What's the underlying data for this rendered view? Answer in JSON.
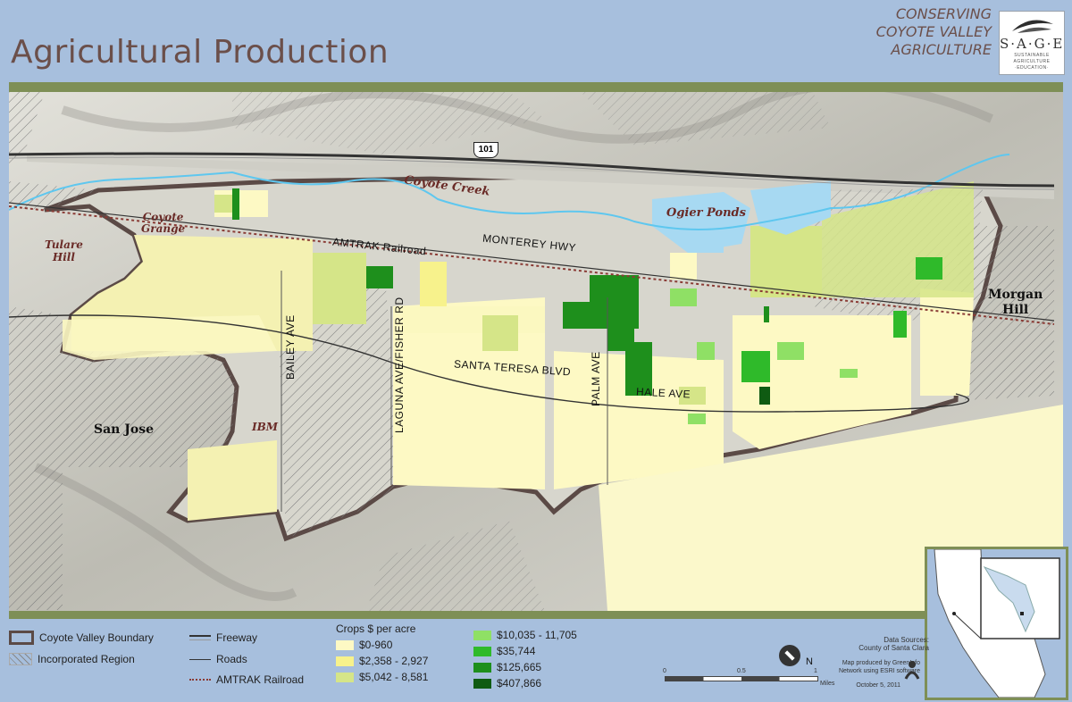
{
  "header": {
    "title": "Agricultural Production",
    "project_lines": [
      "CONSERVING",
      "COYOTE VALLEY",
      "AGRICULTURE"
    ],
    "logo": {
      "word": "S·A·G·E",
      "lines": [
        "SUSTAINABLE",
        "AGRICULTURE",
        "·EDUCATION·"
      ]
    }
  },
  "map": {
    "highway_shield": "101",
    "roads": {
      "bailey": "BAILEY AVE",
      "laguna": "LAGUNA AVE/FISHER RD",
      "santa_teresa": "SANTA TERESA BLVD",
      "palm": "PALM AVE",
      "hale": "HALE AVE",
      "monterey": "MONTEREY HWY",
      "amtrak": "AMTRAK Railroad"
    },
    "water": {
      "creek": "Coyote Creek",
      "ponds": "Ogier Ponds"
    },
    "places": {
      "grange": "Coyote\nGrange",
      "tulare": "Tulare\nHill",
      "ibm": "IBM"
    },
    "towns": {
      "san_jose": "San Jose",
      "morgan_hill": "Morgan\nHill"
    }
  },
  "legend": {
    "boundary": "Coyote Valley Boundary",
    "incorporated": "Incorporated Region",
    "freeway": "Freeway",
    "roads": "Roads",
    "rail": "AMTRAK Railroad",
    "crops_title": "Crops $ per acre",
    "crop_classes": [
      {
        "label": "$0-960",
        "color": "#fdf9c4"
      },
      {
        "label": "$2,358 - 2,927",
        "color": "#f7f28c"
      },
      {
        "label": "$5,042 - 8,581",
        "color": "#d5e588"
      },
      {
        "label": "$10,035 - 11,705",
        "color": "#8fe065"
      },
      {
        "label": "$35,744",
        "color": "#2fba2a"
      },
      {
        "label": "$125,665",
        "color": "#1e8f1c"
      },
      {
        "label": "$407,866",
        "color": "#0f5b12"
      }
    ]
  },
  "footer": {
    "data_sources": [
      "Data Sources:",
      "County of Santa Clara"
    ],
    "produced_by": [
      "Map produced by GreenInfo",
      "Network using ESRI software"
    ],
    "date": "October 5, 2011",
    "north": "N",
    "scale_labels": [
      "0",
      "0.5",
      "1"
    ],
    "scale_unit": "Miles"
  },
  "colors": {
    "background": "#a7bfdd",
    "band": "#7e8f56",
    "hills": "#cbc9c0",
    "boundary": "#5b4a46",
    "water": "#5ec7ef",
    "ponds": "#a7d9f2"
  }
}
